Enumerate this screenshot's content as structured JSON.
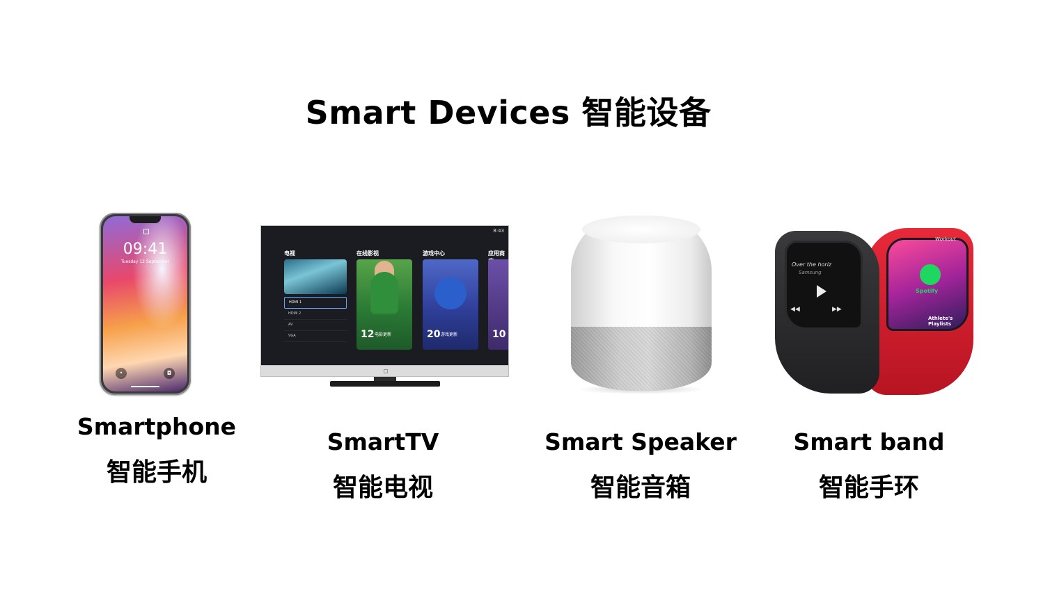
{
  "title": "Smart Devices 智能设备",
  "devices": [
    {
      "en": "Smartphone",
      "zh": "智能手机",
      "icon": "smartphone-icon",
      "screen": {
        "time": "09:41",
        "date": "Tuesday 12 September"
      }
    },
    {
      "en": "SmartTV",
      "zh": "智能电视",
      "icon": "tv-icon",
      "screen": {
        "status": "8:43",
        "sections": [
          "电视",
          "在线影视",
          "游戏中心",
          "应用商店"
        ],
        "inputs": [
          "HDMI 1",
          "HDMI 2",
          "AV",
          "VGA"
        ],
        "cards": [
          {
            "num": "12",
            "text": "电影更新"
          },
          {
            "num": "20",
            "text": "游戏更新"
          },
          {
            "num": "10",
            "text": ""
          }
        ]
      }
    },
    {
      "en": "Smart Speaker",
      "zh": "智能音箱",
      "icon": "speaker-icon"
    },
    {
      "en": "Smart band",
      "zh": "智能手环",
      "icon": "band-icon",
      "screen": {
        "track": "Over the horiz",
        "artist": "Samsung",
        "app": "Spotify",
        "playlist": "Athlete's Playlists",
        "mode": "Workout"
      }
    }
  ]
}
